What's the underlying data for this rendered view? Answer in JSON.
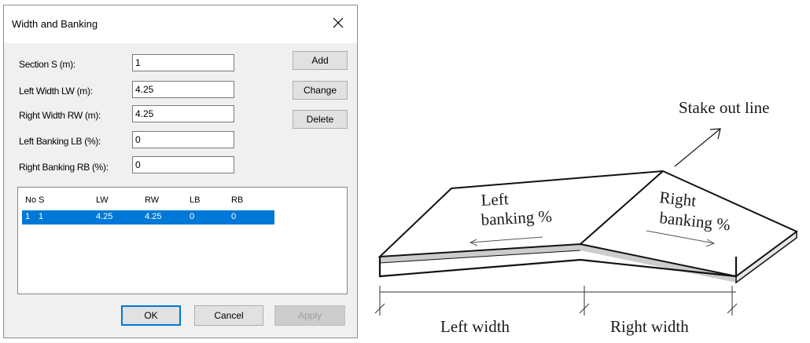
{
  "dialog": {
    "title": "Width and Banking",
    "fields": [
      {
        "label": "Section S (m):",
        "value": "1"
      },
      {
        "label": "Left Width LW (m):",
        "value": "4.25"
      },
      {
        "label": "Right Width RW (m):",
        "value": "4.25"
      },
      {
        "label": "Left Banking LB (%):",
        "value": "0"
      },
      {
        "label": "Right Banking RB (%):",
        "value": "0"
      }
    ],
    "side_buttons": {
      "add": "Add",
      "change": "Change",
      "delete": "Delete"
    },
    "table": {
      "columns": [
        "No",
        "S",
        "LW",
        "RW",
        "LB",
        "RB"
      ],
      "rows": [
        [
          "1",
          "1",
          "4.25",
          "4.25",
          "0",
          "0"
        ]
      ]
    },
    "footer_buttons": {
      "ok": "OK",
      "cancel": "Cancel",
      "apply": "Apply"
    },
    "selected_row_color": "#0078d7"
  },
  "diagram": {
    "stake_label": "Stake out line",
    "left_banking_1": "Left",
    "left_banking_2": "banking %",
    "right_banking_1": "Right",
    "right_banking_2": "banking %",
    "left_width": "Left width",
    "right_width": "Right width"
  }
}
